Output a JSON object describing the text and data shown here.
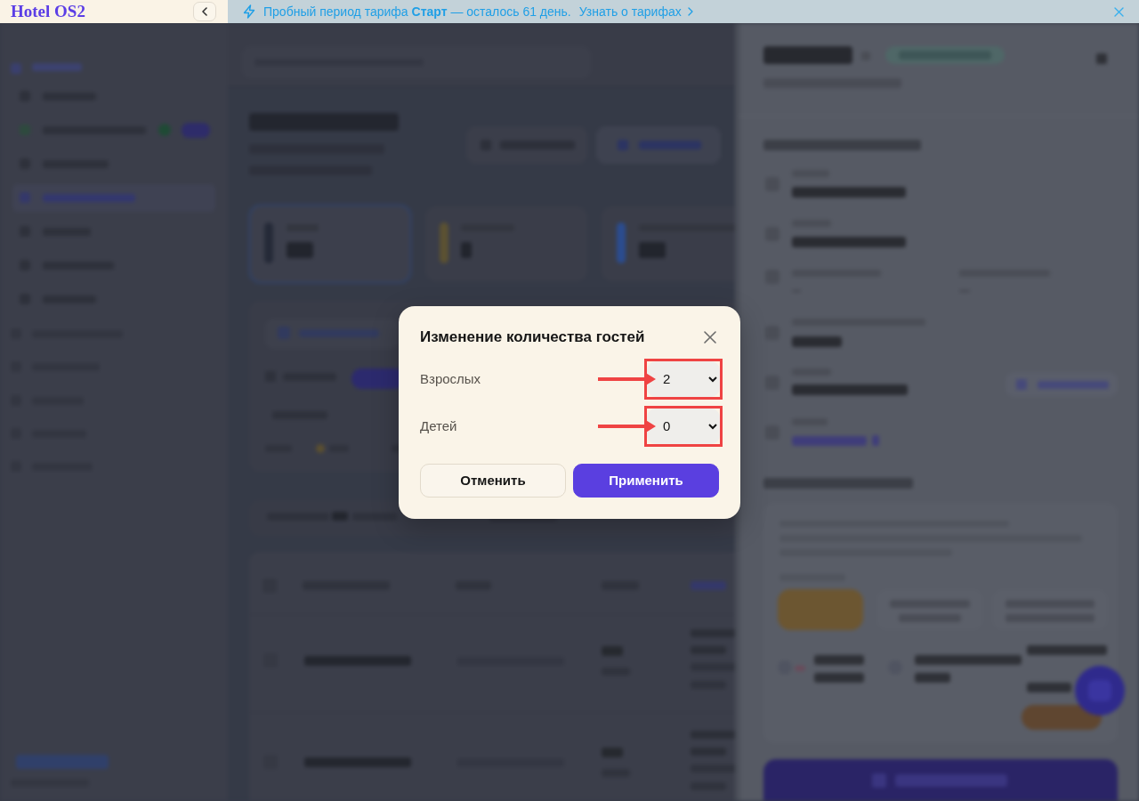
{
  "sidebar": {
    "logo": "Hotel OS2"
  },
  "banner": {
    "message": "Пробный период тарифа **Старт** — осталось 61 день.",
    "link": "Узнать о тарифах"
  },
  "dialog": {
    "title": "Изменение количества гостей",
    "fields": [
      {
        "label": "Взрослых",
        "value": "2",
        "highlighted": true
      },
      {
        "label": "Детей",
        "value": "0",
        "highlighted": true
      }
    ],
    "buttons": [
      {
        "label": "Отменить",
        "kind": "secondary"
      },
      {
        "label": "Применить",
        "kind": "primary"
      }
    ]
  }
}
